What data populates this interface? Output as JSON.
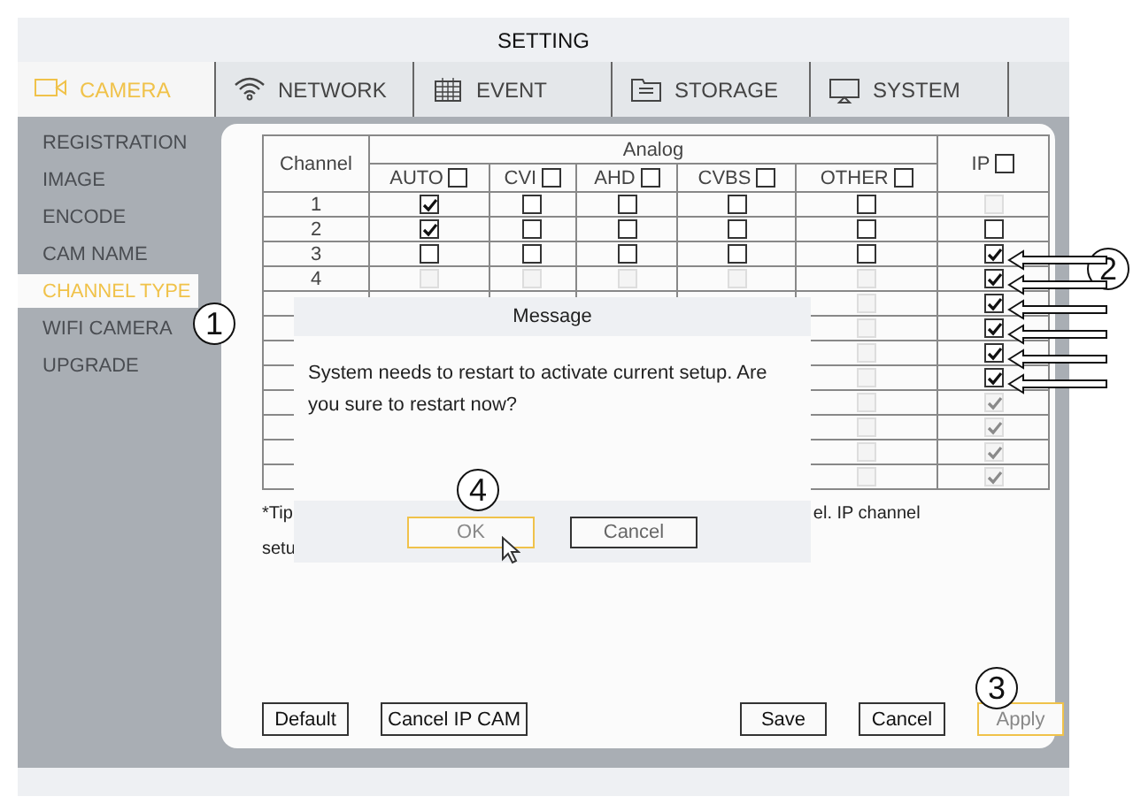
{
  "window": {
    "title": "SETTING"
  },
  "tabs": [
    {
      "label": "CAMERA",
      "selected": true
    },
    {
      "label": "NETWORK",
      "selected": false
    },
    {
      "label": "EVENT",
      "selected": false
    },
    {
      "label": "STORAGE",
      "selected": false
    },
    {
      "label": "SYSTEM",
      "selected": false
    }
  ],
  "sidebar": {
    "items": [
      {
        "label": "REGISTRATION",
        "selected": false
      },
      {
        "label": "IMAGE",
        "selected": false
      },
      {
        "label": "ENCODE",
        "selected": false
      },
      {
        "label": "CAM NAME",
        "selected": false
      },
      {
        "label": "CHANNEL TYPE",
        "selected": true
      },
      {
        "label": "WIFI CAMERA",
        "selected": false
      },
      {
        "label": "UPGRADE",
        "selected": false
      }
    ]
  },
  "table": {
    "channel_header": "Channel",
    "group_header": "Analog",
    "columns": [
      {
        "label": "AUTO",
        "checked": false
      },
      {
        "label": "CVI",
        "checked": false
      },
      {
        "label": "AHD",
        "checked": false
      },
      {
        "label": "CVBS",
        "checked": false
      },
      {
        "label": "OTHER",
        "checked": false
      }
    ],
    "ip_column": {
      "label": "IP",
      "checked": false
    },
    "rows": [
      {
        "channel": "1",
        "analog": [
          {
            "checked": true,
            "disabled": false
          },
          {
            "checked": false,
            "disabled": false
          },
          {
            "checked": false,
            "disabled": false
          },
          {
            "checked": false,
            "disabled": false
          },
          {
            "checked": false,
            "disabled": false
          }
        ],
        "ip": {
          "checked": false,
          "disabled": true
        }
      },
      {
        "channel": "2",
        "analog": [
          {
            "checked": true,
            "disabled": false
          },
          {
            "checked": false,
            "disabled": false
          },
          {
            "checked": false,
            "disabled": false
          },
          {
            "checked": false,
            "disabled": false
          },
          {
            "checked": false,
            "disabled": false
          }
        ],
        "ip": {
          "checked": false,
          "disabled": false
        }
      },
      {
        "channel": "3",
        "analog": [
          {
            "checked": false,
            "disabled": false
          },
          {
            "checked": false,
            "disabled": false
          },
          {
            "checked": false,
            "disabled": false
          },
          {
            "checked": false,
            "disabled": false
          },
          {
            "checked": false,
            "disabled": false
          }
        ],
        "ip": {
          "checked": true,
          "disabled": false
        }
      },
      {
        "channel": "4",
        "analog": [
          {
            "checked": false,
            "disabled": true
          },
          {
            "checked": false,
            "disabled": true
          },
          {
            "checked": false,
            "disabled": true
          },
          {
            "checked": false,
            "disabled": true
          },
          {
            "checked": false,
            "disabled": true
          }
        ],
        "ip": {
          "checked": true,
          "disabled": false
        }
      },
      {
        "other": {
          "checked": false,
          "disabled": true
        },
        "ip": {
          "checked": true,
          "disabled": false
        }
      },
      {
        "other": {
          "checked": false,
          "disabled": true
        },
        "ip": {
          "checked": true,
          "disabled": false
        }
      },
      {
        "other": {
          "checked": false,
          "disabled": true
        },
        "ip": {
          "checked": true,
          "disabled": false
        }
      },
      {
        "other": {
          "checked": false,
          "disabled": true
        },
        "ip": {
          "checked": true,
          "disabled": false
        }
      },
      {
        "other": {
          "checked": false,
          "disabled": true
        },
        "ip": {
          "checked": true,
          "disabled": true
        }
      },
      {
        "other": {
          "checked": false,
          "disabled": true
        },
        "ip": {
          "checked": true,
          "disabled": true
        }
      },
      {
        "other": {
          "checked": false,
          "disabled": true
        },
        "ip": {
          "checked": true,
          "disabled": true
        }
      },
      {
        "other": {
          "checked": false,
          "disabled": true
        },
        "ip": {
          "checked": true,
          "disabled": true
        }
      }
    ]
  },
  "tip": {
    "line_1_start": "*Tip",
    "line_1_end": "el. IP channel",
    "line_2_start": "setu"
  },
  "buttons": [
    {
      "label": "Default",
      "focused": false
    },
    {
      "label": "Cancel IP CAM",
      "focused": false
    },
    {
      "label": "Save",
      "focused": false
    },
    {
      "label": "Cancel",
      "focused": false
    },
    {
      "label": "Apply",
      "focused": true
    }
  ],
  "dialog": {
    "title": "Message",
    "message": "System needs to restart to activate current setup. Are you sure to restart now?",
    "buttons": [
      {
        "label": "OK",
        "focused": true
      },
      {
        "label": "Cancel",
        "focused": false
      }
    ]
  },
  "callouts": [
    {
      "label": "1"
    },
    {
      "label": "2"
    },
    {
      "label": "3"
    },
    {
      "label": "4"
    }
  ]
}
